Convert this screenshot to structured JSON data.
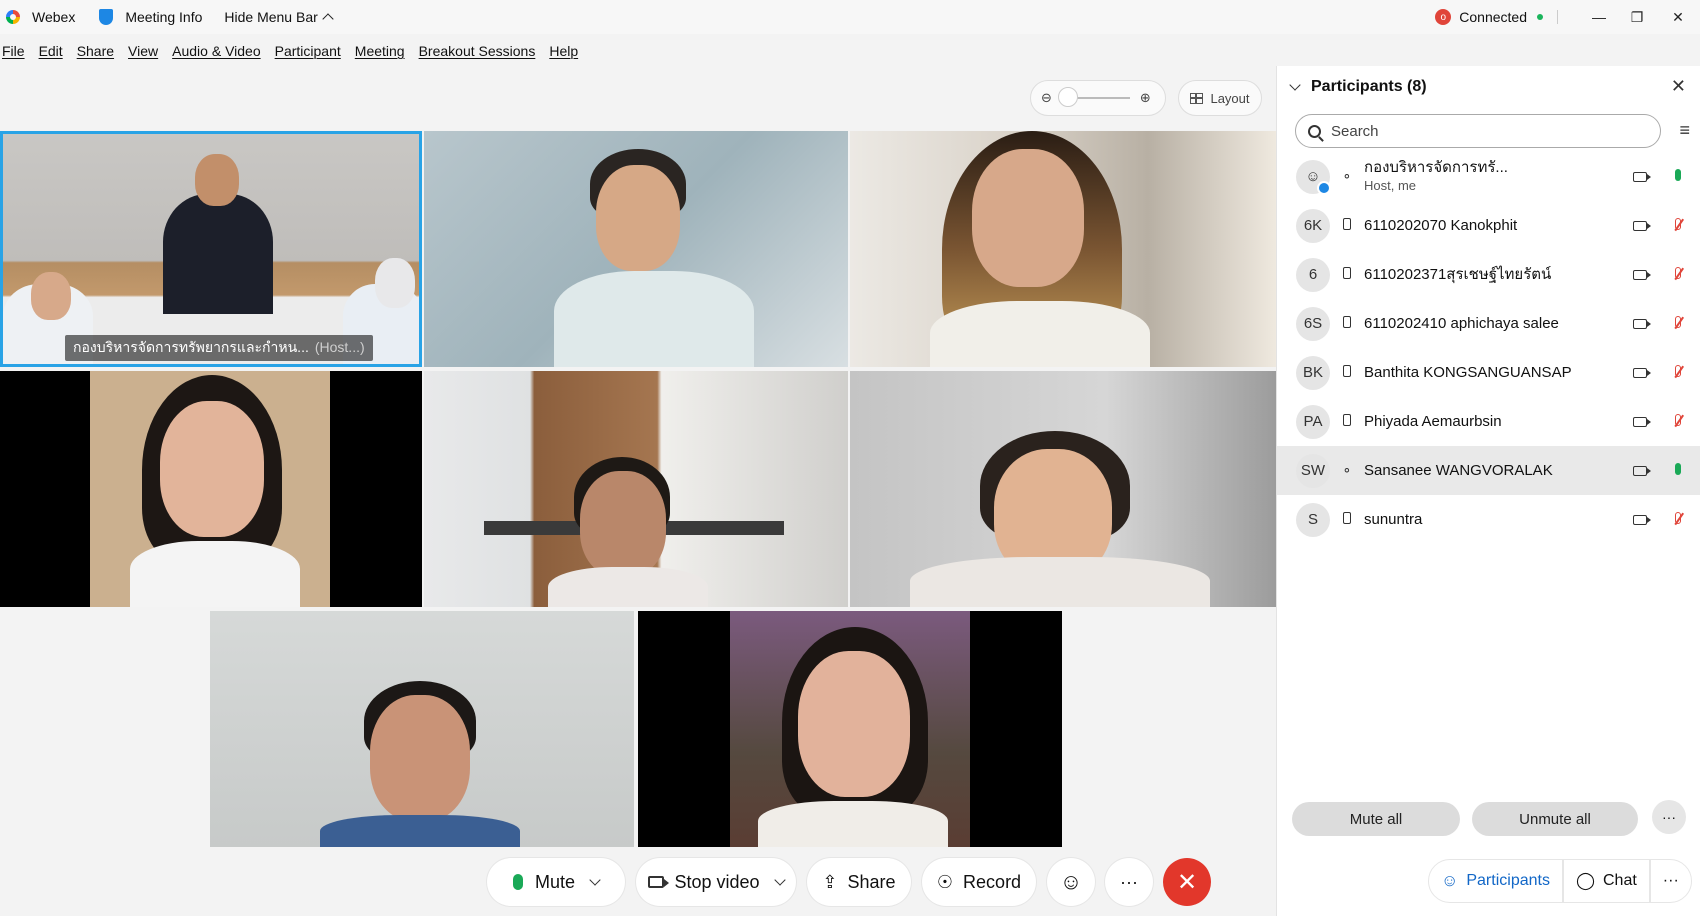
{
  "titlebar": {
    "app": "Webex",
    "meeting_info": "Meeting Info",
    "hide_menu": "Hide Menu Bar",
    "status": "Connected"
  },
  "menu": [
    "File",
    "Edit",
    "Share",
    "View",
    "Audio & Video",
    "Participant",
    "Meeting",
    "Breakout Sessions",
    "Help"
  ],
  "view": {
    "layout_label": "Layout"
  },
  "video": {
    "host_tag": "กองบริหารจัดการทรัพยากรและกำหน...",
    "host_suffix": "(Host...)"
  },
  "controls": {
    "mute": "Mute",
    "stop_video": "Stop video",
    "share": "Share",
    "record": "Record",
    "more": "···",
    "leave": "✕"
  },
  "panel": {
    "title": "Participants (8)",
    "search_placeholder": "Search",
    "mute_all": "Mute all",
    "unmute_all": "Unmute all",
    "more": "···",
    "tab_participants": "Participants",
    "tab_chat": "Chat",
    "tab_more": "···",
    "participants": [
      {
        "initials": "",
        "name": "กองบริหารจัดการทรั...",
        "sub": "Host, me",
        "device": "headset",
        "mic": "on",
        "me": true
      },
      {
        "initials": "6K",
        "name": "6110202070 Kanokphit",
        "sub": "",
        "device": "phone",
        "mic": "off"
      },
      {
        "initials": "6",
        "name": "6110202371สุรเชษฐ์ไทยรัตน์",
        "sub": "",
        "device": "phone",
        "mic": "off"
      },
      {
        "initials": "6S",
        "name": "6110202410 aphichaya salee",
        "sub": "",
        "device": "phone",
        "mic": "off"
      },
      {
        "initials": "BK",
        "name": "Banthita KONGSANGUANSAP",
        "sub": "",
        "device": "phone",
        "mic": "off"
      },
      {
        "initials": "PA",
        "name": "Phiyada Aemaurbsin",
        "sub": "",
        "device": "phone",
        "mic": "off"
      },
      {
        "initials": "SW",
        "name": "Sansanee WANGVORALAK",
        "sub": "",
        "device": "headset",
        "mic": "on",
        "highlight": true
      },
      {
        "initials": "S",
        "name": "sununtra",
        "sub": "",
        "device": "phone",
        "mic": "off"
      }
    ]
  }
}
